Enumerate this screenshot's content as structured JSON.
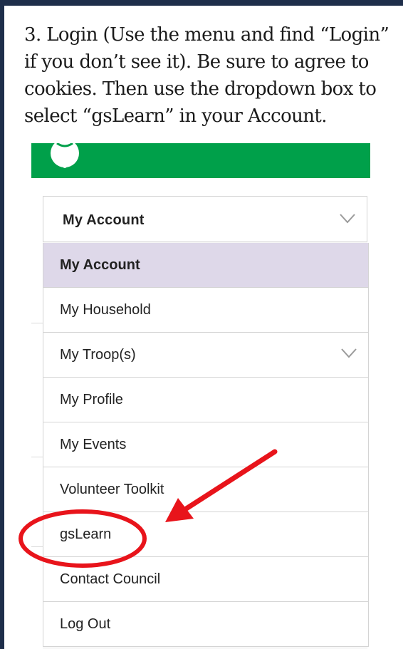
{
  "instruction": {
    "lines": [
      "3. Login (Use the menu and find “Login”",
      "if you don’t see it). Be sure to agree to",
      "cookies. Then use the dropdown box to",
      "select “gsLearn” in your Account."
    ]
  },
  "header": {
    "brand_color": "#00a04a",
    "logo_icon": "trefoil-logo-icon"
  },
  "account_select": {
    "selected": "My Account",
    "icon": "chevron-down-icon"
  },
  "menu": {
    "items": [
      {
        "label": "My Account",
        "active": true
      },
      {
        "label": "My Household"
      },
      {
        "label": "My Troop(s)",
        "has_submenu": true
      },
      {
        "label": "My Profile"
      },
      {
        "label": "My Events"
      },
      {
        "label": "Volunteer Toolkit"
      },
      {
        "label": "gsLearn",
        "highlighted": true
      },
      {
        "label": "Contact Council"
      },
      {
        "label": "Log Out"
      }
    ],
    "active_color": "#ded8e9"
  },
  "annotation": {
    "color": "#e8141b",
    "shapes": [
      "red-circle",
      "red-arrow"
    ]
  }
}
